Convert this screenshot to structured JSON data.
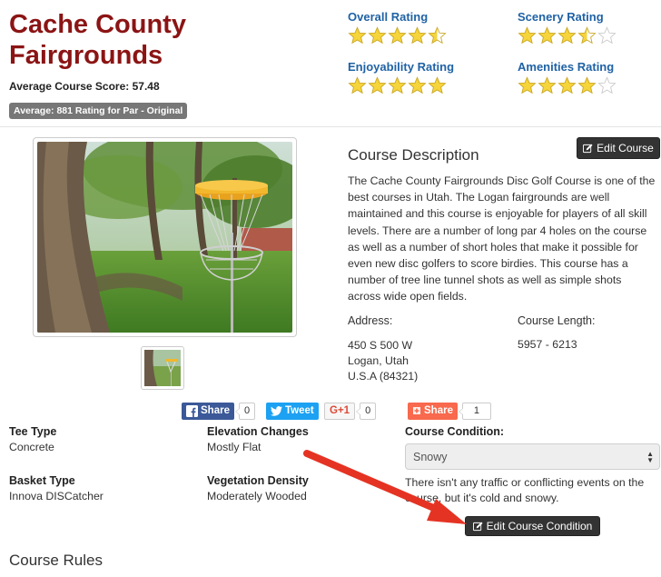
{
  "course": {
    "title": "Cache County Fairgrounds",
    "average_score": "Average Course Score: 57.48",
    "rating_label": "Average: 881 Rating for Par - Original"
  },
  "ratings": [
    {
      "label": "Overall Rating",
      "stars": 4.5
    },
    {
      "label": "Scenery Rating",
      "stars": 3.5
    },
    {
      "label": "Enjoyability Rating",
      "stars": 5
    },
    {
      "label": "Amenities Rating",
      "stars": 4
    }
  ],
  "description": {
    "heading": "Course Description",
    "edit_label": "Edit Course",
    "text": "The Cache County Fairgrounds Disc Golf Course is one of the best courses in Utah. The Logan fairgrounds are well maintained and this course is enjoyable for players of all skill levels. There are a number of long par 4 holes on the course as well as a number of short holes that make it possible for even new disc golfers to score birdies. This course has a number of tree line tunnel shots as well as simple shots across wide open fields."
  },
  "address": {
    "label": "Address:",
    "line1": "450 S 500 W",
    "line2": "Logan, Utah",
    "line3": "U.S.A (84321)"
  },
  "length": {
    "label": "Course Length:",
    "value": "5957 - 6213"
  },
  "share": {
    "facebook_label": "Share",
    "facebook_count": "0",
    "twitter_label": "Tweet",
    "gplus_label": "G+1",
    "gplus_count": "0",
    "addthis_label": "Share",
    "addthis_count": "1"
  },
  "properties": {
    "tee_type_label": "Tee Type",
    "tee_type": "Concrete",
    "elevation_label": "Elevation Changes",
    "elevation": "Mostly Flat",
    "basket_label": "Basket Type",
    "basket": "Innova DISCatcher",
    "vegetation_label": "Vegetation Density",
    "vegetation": "Moderately Wooded"
  },
  "condition": {
    "label": "Course Condition:",
    "selected": "Snowy",
    "note": "There isn't any traffic or conflicting events on the course, but it's cold and snowy.",
    "edit_label": "Edit Course Condition"
  },
  "rules": {
    "heading": "Course Rules"
  },
  "colors": {
    "title": "#8b1414",
    "rating_title": "#1f62a5",
    "star_fill": "#f5d43c",
    "facebook": "#3b5998",
    "twitter": "#1da1f2",
    "addthis": "#f8694d",
    "arrow": "#e53323"
  }
}
